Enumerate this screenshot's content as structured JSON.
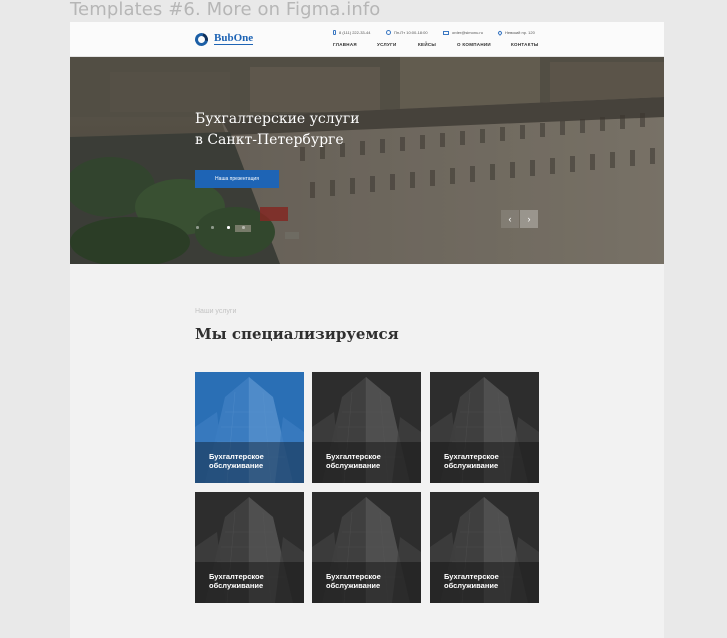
{
  "canvas_title": "Templates #6. More on Figma.info",
  "header": {
    "logo_text": "BubOne",
    "phone": "8 (111) 222-33-44",
    "hours": "Пн-Пт 10:00-18:00",
    "email": "order@simonu.ru",
    "address": "Невский пр. 120",
    "nav": [
      "ГЛАВНАЯ",
      "УСЛУГИ",
      "КЕЙСЫ",
      "О КОМПАНИИ",
      "КОНТАКТЫ"
    ]
  },
  "hero": {
    "title_line1": "Бухгалтерские услуги",
    "title_line2": "в Санкт-Петербурге",
    "button_label": "Наша презентация",
    "slides_total": 4,
    "slide_active": 3,
    "prev_arrow": "‹",
    "next_arrow": "›"
  },
  "services": {
    "kicker": "Наши услуги",
    "title": "Мы специализируемся",
    "cards": [
      {
        "line1": "Бухгалтерское",
        "line2": "обслуживание",
        "highlighted": true
      },
      {
        "line1": "Бухгалтерское",
        "line2": "обслуживание",
        "highlighted": false
      },
      {
        "line1": "Бухгалтерское",
        "line2": "обслуживание",
        "highlighted": false
      },
      {
        "line1": "Бухгалтерское",
        "line2": "обслуживание",
        "highlighted": false
      },
      {
        "line1": "Бухгалтерское",
        "line2": "обслуживание",
        "highlighted": false
      },
      {
        "line1": "Бухгалтерское",
        "line2": "обслуживание",
        "highlighted": false
      }
    ]
  },
  "colors": {
    "accent": "#1e64b5",
    "card_highlight": "#2a6fb5",
    "card_dark": "#2d2d2d"
  }
}
